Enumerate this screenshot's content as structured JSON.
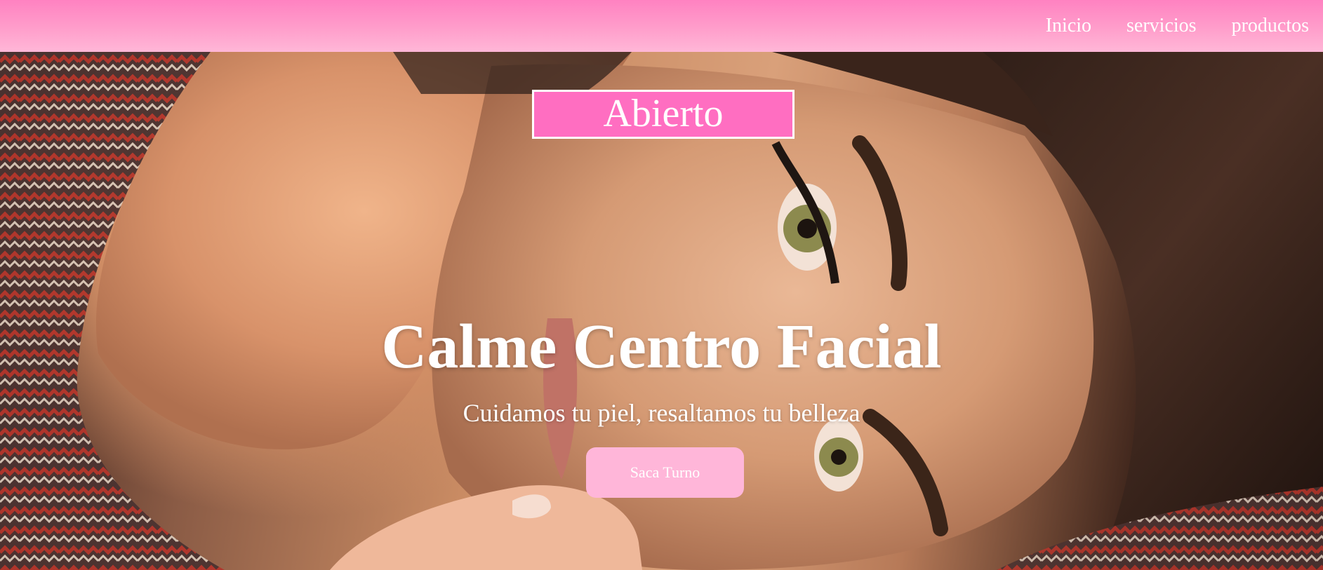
{
  "nav": {
    "items": [
      {
        "label": "Inicio"
      },
      {
        "label": "servicios"
      },
      {
        "label": "productos"
      }
    ]
  },
  "hero": {
    "status_badge": "Abierto",
    "title": "Calme Centro Facial",
    "subtitle": "Cuidamos tu piel, resaltamos tu belleza",
    "cta_label": "Saca Turno",
    "background_image": "woman-face-portrait"
  },
  "colors": {
    "nav_gradient_top": "#ff82c1",
    "nav_gradient_bottom": "#ffb7d7",
    "badge_bg": "#ff6ec1",
    "cta_bg": "#ffb6d9",
    "text": "#ffffff"
  }
}
